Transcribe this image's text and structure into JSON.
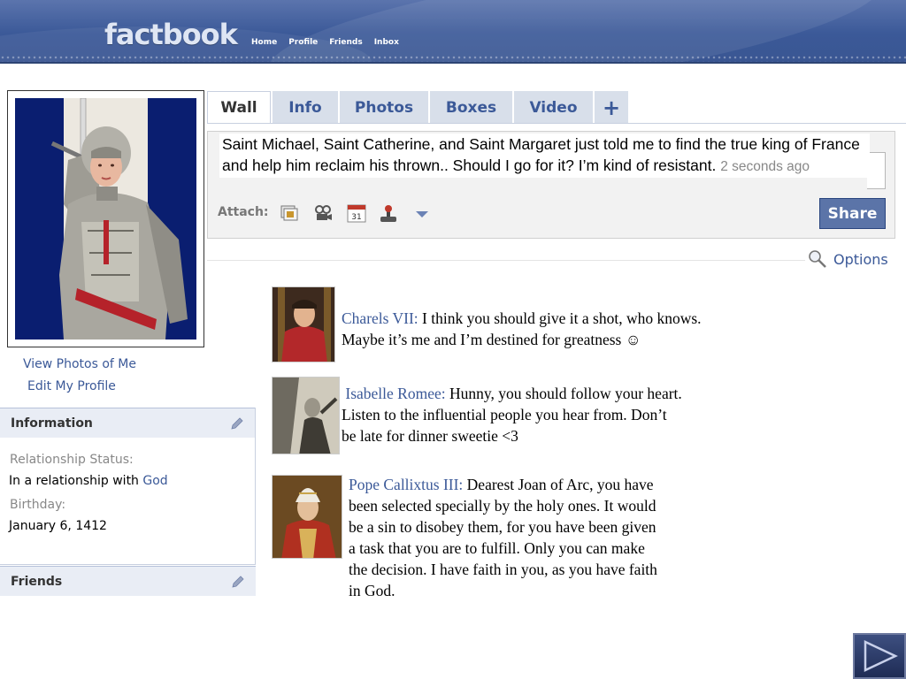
{
  "header": {
    "logo": "factbook",
    "nav": [
      "Home",
      "Profile",
      "Friends",
      "Inbox"
    ]
  },
  "sidebar": {
    "view_photos": "View Photos of Me",
    "edit_profile": "Edit My Profile",
    "information": {
      "title": "Information",
      "relationship_label": "Relationship Status:",
      "relationship_prefix": "In a relationship with ",
      "relationship_partner": "God",
      "birthday_label": "Birthday:",
      "birthday_value": "January 6, 1412"
    },
    "friends_title": "Friends"
  },
  "tabs": [
    "Wall",
    "Info",
    "Photos",
    "Boxes",
    "Video",
    "+"
  ],
  "composer": {
    "status_text": "Saint Michael, Saint Catherine, and Saint Margaret just told me to find the true king of France and help him reclaim his thrown.. Should I go for it? I’m kind of resistant.",
    "status_time": "2 seconds ago",
    "attach_label": "Attach:",
    "attach_icons": [
      "photo-icon",
      "video-icon",
      "calendar-icon",
      "joystick-icon",
      "dropdown-arrow-icon"
    ],
    "calendar_day": "31",
    "share_label": "Share"
  },
  "options_label": "Options",
  "posts": [
    {
      "author": "Charels VII:",
      "lines": [
        "I think you should give it a shot, who knows.",
        "Maybe it’s me and I’m destined for greatness ☺"
      ]
    },
    {
      "author": "Isabelle Romee:",
      "lines": [
        "Hunny, you should follow your heart.",
        "Listen to the influential people you hear from. Don’t",
        "be late for dinner sweetie <3"
      ]
    },
    {
      "author": "Pope Callixtus III:",
      "lines": [
        "Dearest Joan of Arc,  you have",
        "been selected specially by the holy ones. It would",
        "be a sin to disobey them, for you have been given",
        "a task that you are to fulfill. Only you can make",
        "the decision. I have faith in you, as you have faith",
        "in God."
      ]
    }
  ],
  "colors": {
    "brand": "#3b5998",
    "tab_bg": "#d8dfea",
    "share_bg": "#5b74a8"
  }
}
